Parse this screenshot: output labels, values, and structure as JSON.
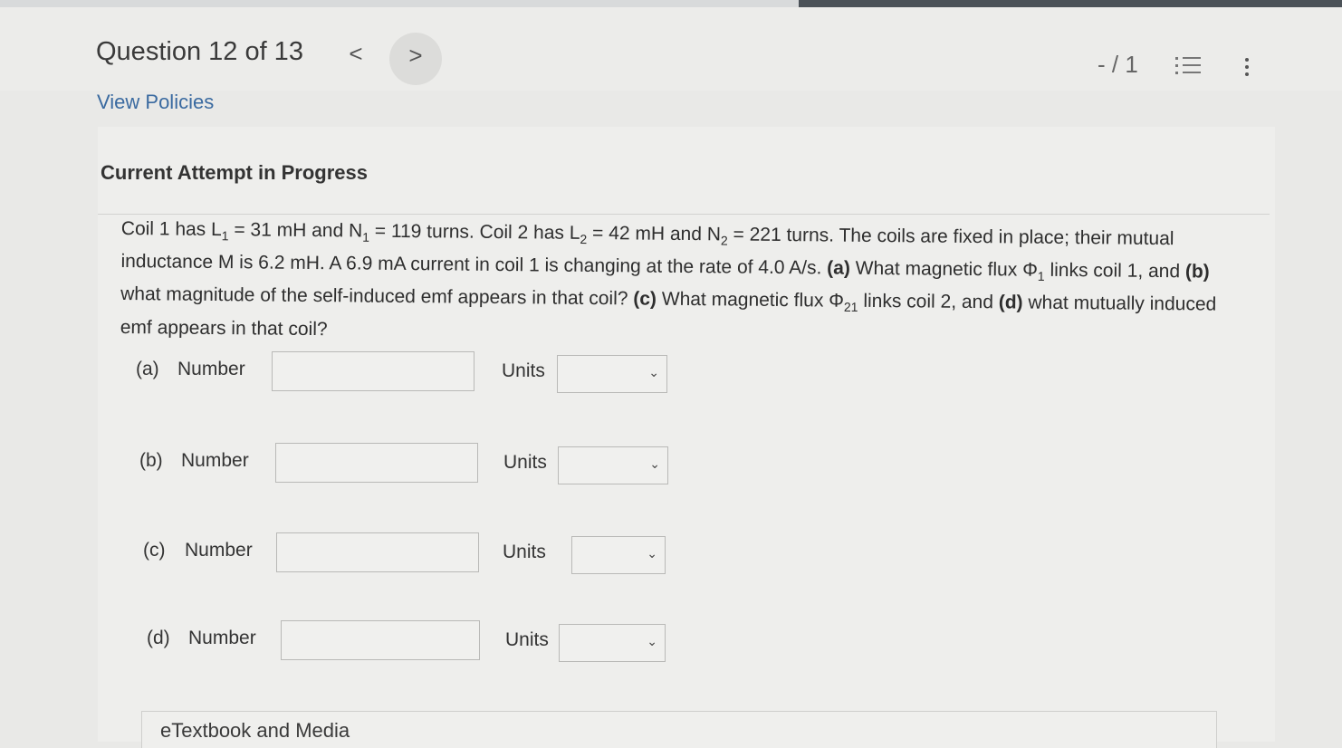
{
  "header": {
    "question_title": "Question 12 of 13",
    "prev_glyph": "<",
    "next_glyph": ">",
    "score": "- / 1"
  },
  "view_policies": "View Policies",
  "attempt_heading": "Current Attempt in Progress",
  "question": {
    "segments": [
      "Coil 1 has L",
      "1",
      " = 31 mH and N",
      "1",
      " = 119 turns. Coil 2 has L",
      "2",
      " = 42 mH and N",
      "2",
      " = 221 turns. The coils are fixed in place; their mutual inductance M is 6.2 mH. A 6.9 mA current in coil 1 is changing at the rate of 4.0 A/s. ",
      "(a)",
      " What magnetic flux Φ",
      "1",
      " links coil 1, and ",
      "(b)",
      " what magnitude of the self-induced emf appears in that coil? ",
      "(c)",
      " What magnetic flux Φ",
      "21",
      " links coil 2, and ",
      "(d)",
      " what mutually induced emf appears in that coil?"
    ]
  },
  "answers": [
    {
      "letter": "(a)",
      "number_label": "Number",
      "value": "",
      "units_label": "Units",
      "units_value": ""
    },
    {
      "letter": "(b)",
      "number_label": "Number",
      "value": "",
      "units_label": "Units",
      "units_value": ""
    },
    {
      "letter": "(c)",
      "number_label": "Number",
      "value": "",
      "units_label": "Units",
      "units_value": ""
    },
    {
      "letter": "(d)",
      "number_label": "Number",
      "value": "",
      "units_label": "Units",
      "units_value": ""
    }
  ],
  "etextbook": "eTextbook and Media",
  "icons": {
    "prev": "chevron-left-icon",
    "next": "chevron-right-icon",
    "list": "list-icon",
    "more": "more-vertical-icon",
    "chevron": "chevron-down-icon"
  },
  "colors": {
    "link": "#3a6aa0",
    "background": "#e9e9e7"
  }
}
